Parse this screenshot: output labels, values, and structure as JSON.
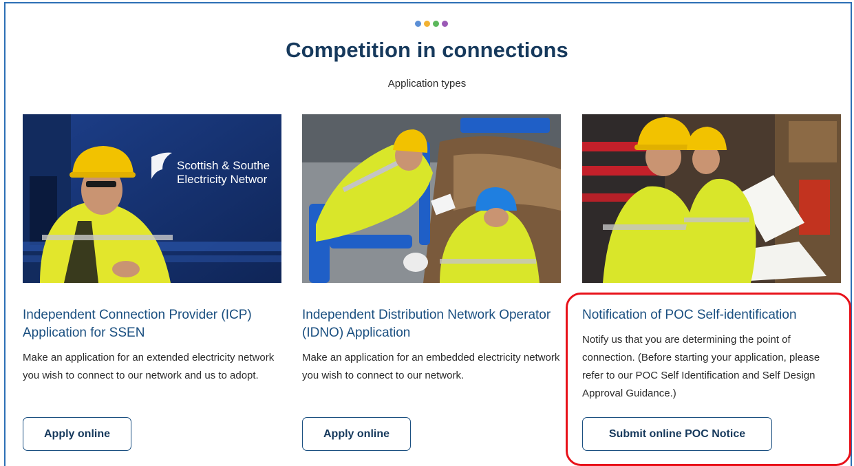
{
  "header": {
    "dot_colors": [
      "#5b8fd6",
      "#f2b233",
      "#5cb85c",
      "#9b59b6"
    ],
    "title": "Competition in connections",
    "subtitle": "Application types"
  },
  "cards": [
    {
      "image_label": "Worker in hard hat beside Scottish & Southern Electricity Networks van",
      "van_text_line1": "Scottish & Southe",
      "van_text_line2": "Electricity Networ",
      "title": "Independent Connection Provider (ICP) Application for SSEN",
      "description": "Make an application for an extended electricity network you wish to connect to our network and us to adopt.",
      "button_label": "Apply online"
    },
    {
      "image_label": "Two workers in hard hats at an excavation",
      "title": "Independent Distribution Network Operator (IDNO) Application",
      "description": "Make an application for an embedded electricity network you wish to connect to our network.",
      "button_label": "Apply online"
    },
    {
      "image_label": "Two workers reviewing plans in a van",
      "title": "Notification of POC Self-identification",
      "description": "Notify us that you are determining the point of connection. (Before starting your application, please refer to our POC Self Identification and Self Design Approval Guidance.)",
      "button_label": "Submit online POC Notice"
    }
  ],
  "colors": {
    "accent": "#1a4f80",
    "highlight": "#e8121a",
    "frame": "#2c6fb5"
  }
}
